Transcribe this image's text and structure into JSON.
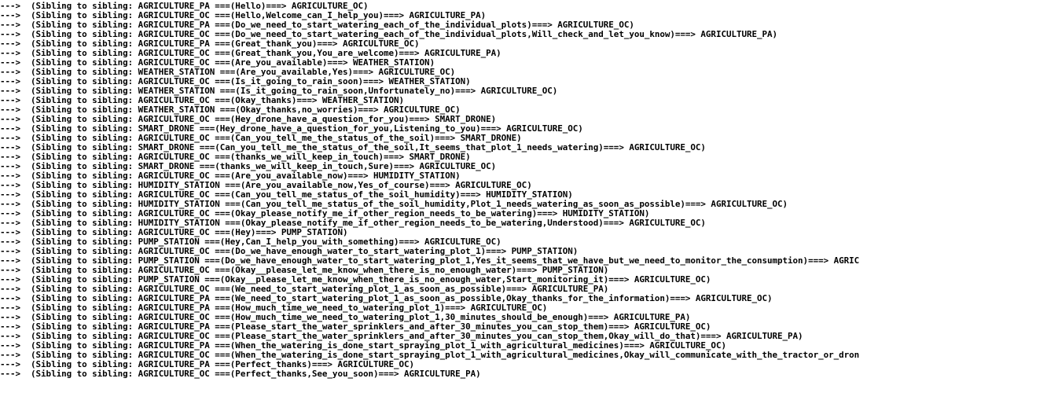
{
  "console": {
    "lines": [
      "--->  (Sibling to sibling: AGRICULTURE_PA ===(Hello)===> AGRICULTURE_OC)",
      "--->  (Sibling to sibling: AGRICULTURE_OC ===(Hello,Welcome_can_I_help_you)===> AGRICULTURE_PA)",
      "--->  (Sibling to sibling: AGRICULTURE_PA ===(Do_we_need_to_start_watering_each_of_the_individual_plots)===> AGRICULTURE_OC)",
      "--->  (Sibling to sibling: AGRICULTURE_OC ===(Do_we_need_to_start_watering_each_of_the_individual_plots,Will_check_and_let_you_know)===> AGRICULTURE_PA)",
      "--->  (Sibling to sibling: AGRICULTURE_PA ===(Great_thank_you)===> AGRICULTURE_OC)",
      "--->  (Sibling to sibling: AGRICULTURE_OC ===(Great_thank_you,You_are_welcome)===> AGRICULTURE_PA)",
      "--->  (Sibling to sibling: AGRICULTURE_OC ===(Are_you_available)===> WEATHER_STATION)",
      "--->  (Sibling to sibling: WEATHER_STATION ===(Are_you_available,Yes)===> AGRICULTURE_OC)",
      "--->  (Sibling to sibling: AGRICULTURE_OC ===(Is_it_going_to_rain_soon)===> WEATHER_STATION)",
      "--->  (Sibling to sibling: WEATHER_STATION ===(Is_it_going_to_rain_soon,Unfortunately_no)===> AGRICULTURE_OC)",
      "--->  (Sibling to sibling: AGRICULTURE_OC ===(Okay_thanks)===> WEATHER_STATION)",
      "--->  (Sibling to sibling: WEATHER_STATION ===(Okay_thanks,no_worries)===> AGRICULTURE_OC)",
      "--->  (Sibling to sibling: AGRICULTURE_OC ===(Hey_drone_have_a_question_for_you)===> SMART_DRONE)",
      "--->  (Sibling to sibling: SMART_DRONE ===(Hey_drone_have_a_question_for_you,Listening_to_you)===> AGRICULTURE_OC)",
      "--->  (Sibling to sibling: AGRICULTURE_OC ===(Can_you_tell_me_the_status_of_the_soil)===> SMART_DRONE)",
      "--->  (Sibling to sibling: SMART_DRONE ===(Can_you_tell_me_the_status_of_the_soil,It_seems_that_plot_1_needs_watering)===> AGRICULTURE_OC)",
      "--->  (Sibling to sibling: AGRICULTURE_OC ===(thanks_we_will_keep_in_touch)===> SMART_DRONE)",
      "--->  (Sibling to sibling: SMART_DRONE ===(thanks_we_will_keep_in_touch,Sure)===> AGRICULTURE_OC)",
      "--->  (Sibling to sibling: AGRICULTURE_OC ===(Are_you_available_now)===> HUMIDITY_STATION)",
      "--->  (Sibling to sibling: HUMIDITY_STATION ===(Are_you_available_now,Yes_of_course)===> AGRICULTURE_OC)",
      "--->  (Sibling to sibling: AGRICULTURE_OC ===(Can_you_tell_me_status_of_the_soil_humidity)===> HUMIDITY_STATION)",
      "--->  (Sibling to sibling: HUMIDITY_STATION ===(Can_you_tell_me_status_of_the_soil_humidity,Plot_1_needs_watering_as_soon_as_possible)===> AGRICULTURE_OC)",
      "--->  (Sibling to sibling: AGRICULTURE_OC ===(Okay_please_notify_me_if_other_region_needs_to_be_watering)===> HUMIDITY_STATION)",
      "--->  (Sibling to sibling: HUMIDITY_STATION ===(Okay_please_notify_me_if_other_region_needs_to_be_watering,Understood)===> AGRICULTURE_OC)",
      "--->  (Sibling to sibling: AGRICULTURE_OC ===(Hey)===> PUMP_STATION)",
      "--->  (Sibling to sibling: PUMP_STATION ===(Hey,Can_I_help_you_with_something)===> AGRICULTURE_OC)",
      "--->  (Sibling to sibling: AGRICULTURE_OC ===(Do_we_have_enough_water_to_start_watering_plot_1)===> PUMP_STATION)",
      "--->  (Sibling to sibling: PUMP_STATION ===(Do_we_have_enough_water_to_start_watering_plot_1,Yes_it_seems_that_we_have_but_we_need_to_monitor_the_consumption)===> AGRIC",
      "--->  (Sibling to sibling: AGRICULTURE_OC ===(Okay__please_let_me_know_when_there_is_no_enough_water)===> PUMP_STATION)",
      "--->  (Sibling to sibling: PUMP_STATION ===(Okay__please_let_me_know_when_there_is_no_enough_water,Start_monitoring_it)===> AGRICULTURE_OC)",
      "--->  (Sibling to sibling: AGRICULTURE_OC ===(We_need_to_start_watering_plot_1_as_soon_as_possible)===> AGRICULTURE_PA)",
      "--->  (Sibling to sibling: AGRICULTURE_PA ===(We_need_to_start_watering_plot_1_as_soon_as_possible,Okay_thanks_for_the_information)===> AGRICULTURE_OC)",
      "--->  (Sibling to sibling: AGRICULTURE_PA ===(How_much_time_we_need_to_watering_plot_1)===> AGRICULTURE_OC)",
      "--->  (Sibling to sibling: AGRICULTURE_OC ===(How_much_time_we_need_to_watering_plot_1,30_minutes_should_be_enough)===> AGRICULTURE_PA)",
      "--->  (Sibling to sibling: AGRICULTURE_PA ===(Please_start_the_water_sprinklers_and_after_30_minutes_you_can_stop_them)===> AGRICULTURE_OC)",
      "--->  (Sibling to sibling: AGRICULTURE_OC ===(Please_start_the_water_sprinklers_and_after_30_minutes_you_can_stop_them,Okay_will_do_that)===> AGRICULTURE_PA)",
      "--->  (Sibling to sibling: AGRICULTURE_PA ===(When_the_watering_is_done_start_spraying_plot_1_with_agricultural_medicines)===> AGRICULTURE_OC)",
      "--->  (Sibling to sibling: AGRICULTURE_OC ===(When_the_watering_is_done_start_spraying_plot_1_with_agricultural_medicines,Okay_will_communicate_with_the_tractor_or_dron",
      "--->  (Sibling to sibling: AGRICULTURE_PA ===(Perfect_thanks)===> AGRICULTURE_OC)",
      "--->  (Sibling to sibling: AGRICULTURE_OC ===(Perfect_thanks,See_you_soon)===> AGRICULTURE_PA)"
    ]
  }
}
